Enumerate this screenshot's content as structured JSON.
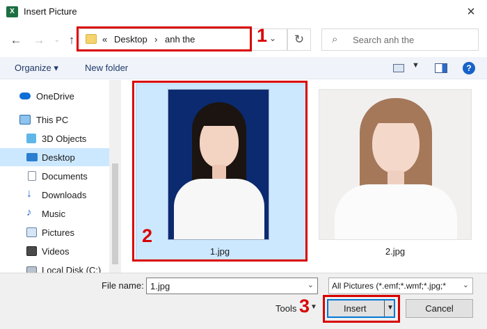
{
  "window": {
    "app_icon": "X",
    "title": "Insert Picture",
    "close": "×"
  },
  "nav": {
    "back": "←",
    "forward": "→",
    "up": "↑",
    "breadcrumb_prefix": "«",
    "breadcrumbs": [
      "Desktop",
      "anh the"
    ],
    "separator": "›",
    "dropdown": "⌄",
    "refresh": "↻",
    "search_placeholder": "Search anh the"
  },
  "toolbar": {
    "organize": "Organize ▾",
    "new_folder": "New folder",
    "view_dd": "▼",
    "help": "?"
  },
  "sidebar": {
    "items": [
      {
        "label": "OneDrive",
        "icon": "onedrive-icon"
      },
      {
        "label": "This PC",
        "icon": "pc-icon"
      },
      {
        "label": "3D Objects",
        "icon": "3d-objects-icon"
      },
      {
        "label": "Desktop",
        "icon": "desktop-icon",
        "selected": true
      },
      {
        "label": "Documents",
        "icon": "documents-icon"
      },
      {
        "label": "Downloads",
        "icon": "downloads-icon"
      },
      {
        "label": "Music",
        "icon": "music-icon"
      },
      {
        "label": "Pictures",
        "icon": "pictures-icon"
      },
      {
        "label": "Videos",
        "icon": "videos-icon"
      },
      {
        "label": "Local Disk (C:)",
        "icon": "disk-icon"
      }
    ]
  },
  "files": [
    {
      "name": "1.jpg",
      "selected": true
    },
    {
      "name": "2.jpg",
      "selected": false
    }
  ],
  "bottom": {
    "file_name_label": "File name:",
    "file_name_value": "1.jpg",
    "file_type": "All Pictures (*.emf;*.wmf;*.jpg;*",
    "tools": "Tools",
    "insert": "Insert",
    "cancel": "Cancel"
  },
  "annotations": {
    "step1": "1",
    "step2": "2",
    "step3": "3"
  },
  "colors": {
    "highlight": "#d80000",
    "selection": "#cce8ff",
    "accent": "#0078d7"
  }
}
